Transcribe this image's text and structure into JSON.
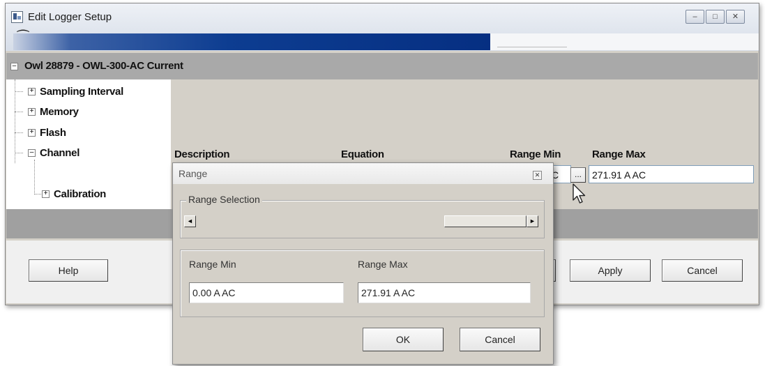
{
  "window": {
    "title": "Edit Logger Setup",
    "caption_buttons": {
      "minimize": "–",
      "maximize": "□",
      "close": "✕"
    }
  },
  "tree": {
    "header": "Owl 28879 - OWL-300-AC Current",
    "items": [
      {
        "label": "Sampling Interval",
        "expanded": false
      },
      {
        "label": "Memory",
        "expanded": false
      },
      {
        "label": "Flash",
        "expanded": false
      },
      {
        "label": "Channel",
        "expanded": true
      },
      {
        "label": "Calibration",
        "expanded": false
      }
    ]
  },
  "channel_table": {
    "headers": [
      "Description",
      "Equation",
      "Range Min",
      "Range Max"
    ],
    "row": {
      "range_min_tail": "C",
      "browse_label": "...",
      "range_max": "271.91 A AC"
    }
  },
  "buttons": {
    "help": "Help",
    "apply": "Apply",
    "cancel": "Cancel"
  },
  "range_dialog": {
    "title": "Range",
    "close_glyph": "✕",
    "selection_group_label": "Range Selection",
    "scroll_left": "◄",
    "scroll_right": "►",
    "min_label": "Range Min",
    "max_label": "Range Max",
    "min_value": "0.00 A AC",
    "max_value": "271.91 A AC",
    "ok": "OK",
    "cancel": "Cancel"
  },
  "icons": [
    "app-icon",
    "expand-icon",
    "collapse-icon",
    "close-icon",
    "scroll-left-icon",
    "scroll-right-icon",
    "mouse-pointer-icon"
  ],
  "colors": {
    "banner": "#0d3d91",
    "tree_header": "#a9a9a9",
    "dialog_face": "#d4d0c8"
  }
}
